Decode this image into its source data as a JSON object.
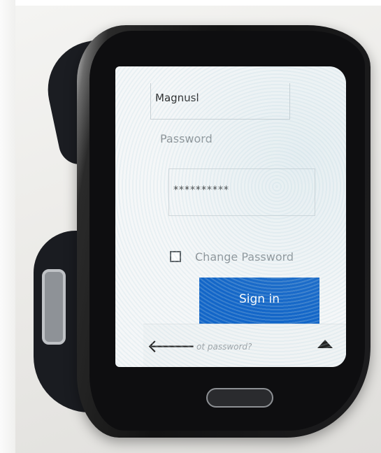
{
  "login": {
    "username_value": "Magnusl",
    "password_label": "Password",
    "password_value": "**********",
    "change_password_label": "Change Password",
    "change_password_checked": false,
    "signin_label": "Sign in",
    "forgot_label": "ot password?"
  },
  "icons": {
    "back": "arrow-left-icon",
    "up": "triangle-up-icon"
  },
  "colors": {
    "signin_button": "#1366c8",
    "screen_bg": "#f5f7f8"
  }
}
